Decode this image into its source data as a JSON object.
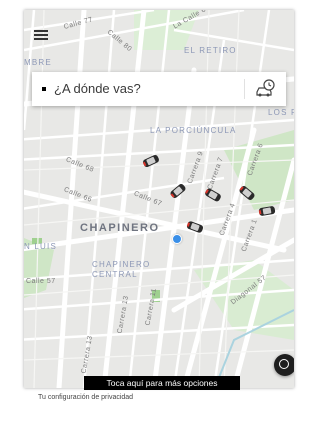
{
  "search": {
    "placeholder": "¿A dónde vas?"
  },
  "map": {
    "labels": {
      "la_calle_63": "La Calle 63",
      "calle_77": "Calle 77",
      "calle_80": "Calle 80",
      "el_retiro": "EL RETIRO",
      "la_mbre": "MBRE",
      "los_r": "LOS R",
      "la_porciuncula": "LA PORCIÚNCULA",
      "calle_68": "Calle 68",
      "calle_66": "Calle 66",
      "calle_67": "Calle 67",
      "carrera_9": "Carrera 9",
      "carrera_7": "Carrera 7",
      "carrera_6": "Carrera 6",
      "carrera_4": "Carrera 4",
      "carrera_1": "Carrera 1",
      "chapinero": "CHAPINERO",
      "chapinero_central": "CHAPINERO CENTRAL",
      "san_luis": "N LUIS",
      "calle_57": "Calle 57",
      "diagonal_57": "Diagonal 57",
      "carrera_13": "Carrera 13",
      "carrera_11": "Carrera 11"
    }
  },
  "tooltip": {
    "text": "Toca aquí para más opciones"
  },
  "footer": {
    "privacy_text": "Tu configuración de privacidad"
  },
  "colors": {
    "map_bg": "#e8e8e6",
    "park": "#cfe6c6",
    "water": "#aad3df",
    "user_dot": "#3a8fe8"
  }
}
